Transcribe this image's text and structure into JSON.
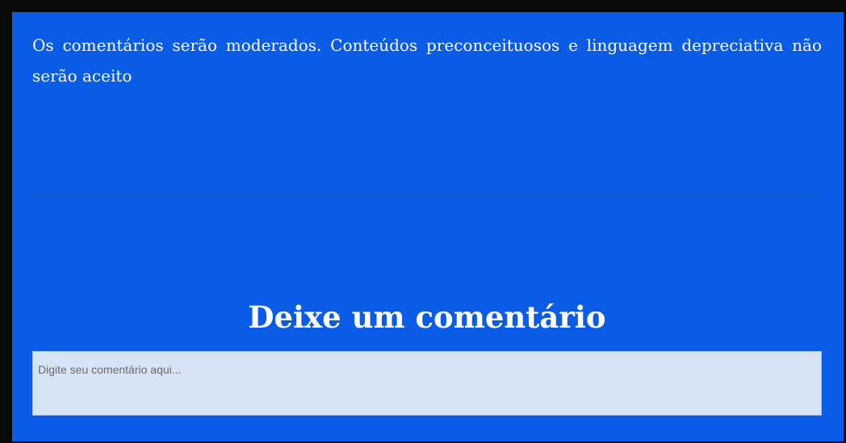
{
  "notice": {
    "text": "Os comentários serão moderados. Conteúdos preconceituosos e linguagem depreciativa não serão aceito"
  },
  "comment_section": {
    "heading": "Deixe um comentário",
    "input": {
      "value": "",
      "placeholder": "Digite seu comentário aqui..."
    }
  },
  "colors": {
    "panel_background": "#0a5ce6",
    "text": "#ffffff",
    "input_background": "#d6e4f6",
    "outer_border": "#0a0a0a"
  }
}
